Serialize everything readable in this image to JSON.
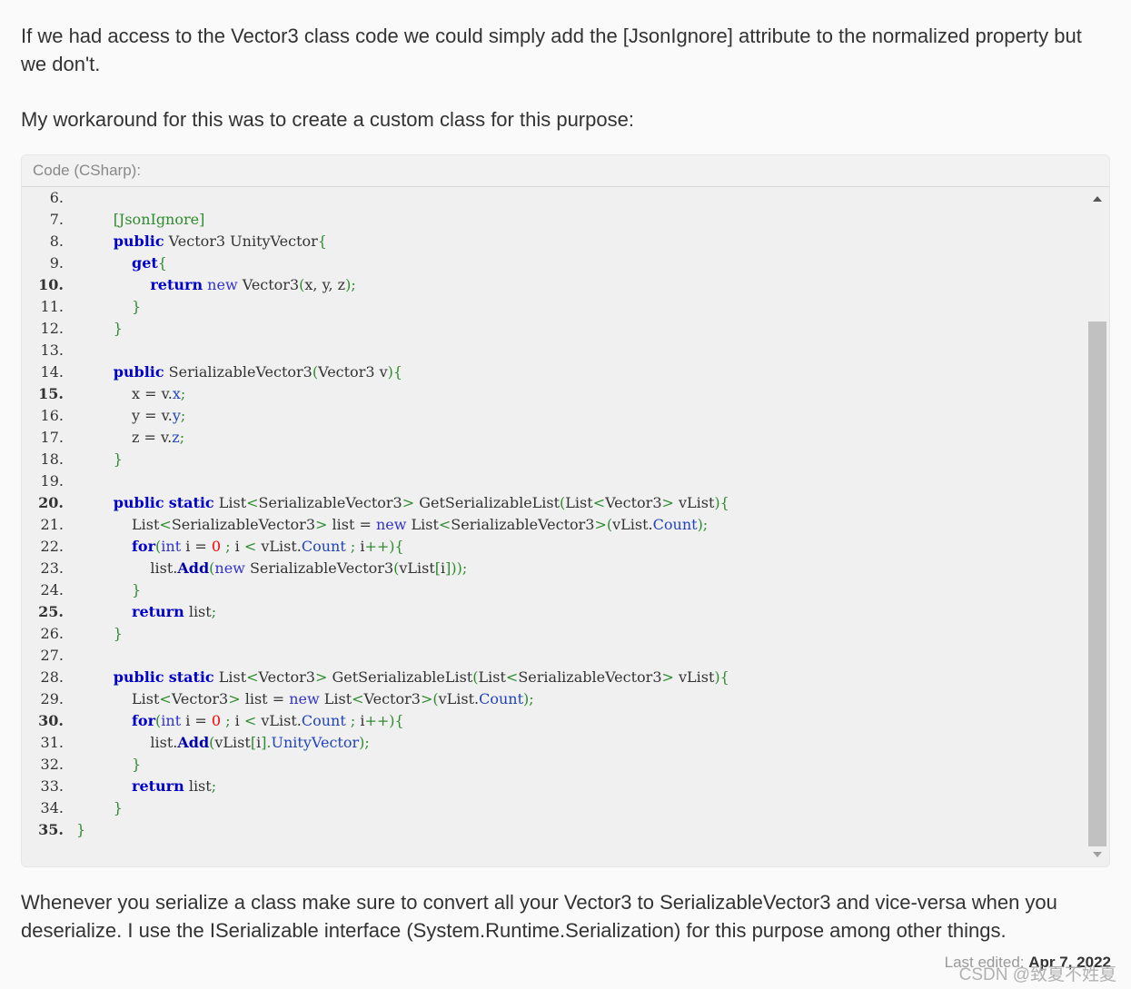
{
  "paragraphs": {
    "p1": "If we had access to the Vector3 class code we could simply add the [JsonIgnore] attribute to the normalized property but we don't.",
    "p2": "My workaround for this was to create a custom class for this purpose:",
    "p3": "Whenever you serialize a class make sure to convert all your Vector3 to SerializableVector3 and vice-versa when you deserialize. I use the ISerializable interface (System.Runtime.Serialization) for this purpose among other things."
  },
  "code_block": {
    "header": "Code (CSharp):",
    "lines": [
      {
        "n": "6.",
        "bold": false
      },
      {
        "n": "7.",
        "bold": false
      },
      {
        "n": "8.",
        "bold": false
      },
      {
        "n": "9.",
        "bold": false
      },
      {
        "n": "10.",
        "bold": true
      },
      {
        "n": "11.",
        "bold": false
      },
      {
        "n": "12.",
        "bold": false
      },
      {
        "n": "13.",
        "bold": false
      },
      {
        "n": "14.",
        "bold": false
      },
      {
        "n": "15.",
        "bold": true
      },
      {
        "n": "16.",
        "bold": false
      },
      {
        "n": "17.",
        "bold": false
      },
      {
        "n": "18.",
        "bold": false
      },
      {
        "n": "19.",
        "bold": false
      },
      {
        "n": "20.",
        "bold": true
      },
      {
        "n": "21.",
        "bold": false
      },
      {
        "n": "22.",
        "bold": false
      },
      {
        "n": "23.",
        "bold": false
      },
      {
        "n": "24.",
        "bold": false
      },
      {
        "n": "25.",
        "bold": true
      },
      {
        "n": "26.",
        "bold": false
      },
      {
        "n": "27.",
        "bold": false
      },
      {
        "n": "28.",
        "bold": false
      },
      {
        "n": "29.",
        "bold": false
      },
      {
        "n": "30.",
        "bold": true
      },
      {
        "n": "31.",
        "bold": false
      },
      {
        "n": "32.",
        "bold": false
      },
      {
        "n": "33.",
        "bold": false
      },
      {
        "n": "34.",
        "bold": false
      },
      {
        "n": "35.",
        "bold": true
      }
    ],
    "tokens": [
      [],
      [
        [
          "pn",
          "        [JsonIgnore]"
        ]
      ],
      [
        [
          "",
          "        "
        ],
        [
          "kw",
          "public"
        ],
        [
          "",
          " Vector3 UnityVector"
        ],
        [
          "pn",
          "{"
        ]
      ],
      [
        [
          "",
          "            "
        ],
        [
          "kw",
          "get"
        ],
        [
          "pn",
          "{"
        ]
      ],
      [
        [
          "",
          "                "
        ],
        [
          "kw",
          "return"
        ],
        [
          "",
          " "
        ],
        [
          "kt",
          "new"
        ],
        [
          "",
          " Vector3"
        ],
        [
          "pn",
          "("
        ],
        [
          "",
          "x, y, z"
        ],
        [
          "pn",
          ");"
        ]
      ],
      [
        [
          "",
          "            "
        ],
        [
          "pn",
          "}"
        ]
      ],
      [
        [
          "",
          "        "
        ],
        [
          "pn",
          "}"
        ]
      ],
      [],
      [
        [
          "",
          "        "
        ],
        [
          "kw",
          "public"
        ],
        [
          "",
          " SerializableVector3"
        ],
        [
          "pn",
          "("
        ],
        [
          "",
          "Vector3 v"
        ],
        [
          "pn",
          "){"
        ]
      ],
      [
        [
          "",
          "            x = v."
        ],
        [
          "mem",
          "x"
        ],
        [
          "pn",
          ";"
        ]
      ],
      [
        [
          "",
          "            y = v."
        ],
        [
          "mem",
          "y"
        ],
        [
          "pn",
          ";"
        ]
      ],
      [
        [
          "",
          "            z = v."
        ],
        [
          "mem",
          "z"
        ],
        [
          "pn",
          ";"
        ]
      ],
      [
        [
          "",
          "        "
        ],
        [
          "pn",
          "}"
        ]
      ],
      [],
      [
        [
          "",
          "        "
        ],
        [
          "kw",
          "public"
        ],
        [
          "",
          " "
        ],
        [
          "kw",
          "static"
        ],
        [
          "",
          " List"
        ],
        [
          "pn",
          "<"
        ],
        [
          "",
          "SerializableVector3"
        ],
        [
          "pn",
          ">"
        ],
        [
          "",
          " GetSerializableList"
        ],
        [
          "pn",
          "("
        ],
        [
          "",
          "List"
        ],
        [
          "pn",
          "<"
        ],
        [
          "",
          "Vector3"
        ],
        [
          "pn",
          ">"
        ],
        [
          "",
          " vList"
        ],
        [
          "pn",
          "){"
        ]
      ],
      [
        [
          "",
          "            List"
        ],
        [
          "pn",
          "<"
        ],
        [
          "",
          "SerializableVector3"
        ],
        [
          "pn",
          ">"
        ],
        [
          "",
          " list = "
        ],
        [
          "kt",
          "new"
        ],
        [
          "",
          " List"
        ],
        [
          "pn",
          "<"
        ],
        [
          "",
          "SerializableVector3"
        ],
        [
          "pn",
          ">("
        ],
        [
          "",
          "vList."
        ],
        [
          "mem",
          "Count"
        ],
        [
          "pn",
          ");"
        ]
      ],
      [
        [
          "",
          "            "
        ],
        [
          "kw",
          "for"
        ],
        [
          "pn",
          "("
        ],
        [
          "kt",
          "int"
        ],
        [
          "",
          " i = "
        ],
        [
          "num",
          "0"
        ],
        [
          "",
          " "
        ],
        [
          "pn",
          ";"
        ],
        [
          "",
          " i "
        ],
        [
          "pn",
          "<"
        ],
        [
          "",
          " vList."
        ],
        [
          "mem",
          "Count"
        ],
        [
          "",
          " "
        ],
        [
          "pn",
          ";"
        ],
        [
          "",
          " i"
        ],
        [
          "pn",
          "++){"
        ]
      ],
      [
        [
          "",
          "                list."
        ],
        [
          "mb",
          "Add"
        ],
        [
          "pn",
          "("
        ],
        [
          "kt",
          "new"
        ],
        [
          "",
          " SerializableVector3"
        ],
        [
          "pn",
          "("
        ],
        [
          "",
          "vList"
        ],
        [
          "pn",
          "["
        ],
        [
          "",
          "i"
        ],
        [
          "pn",
          "]));"
        ]
      ],
      [
        [
          "",
          "            "
        ],
        [
          "pn",
          "}"
        ]
      ],
      [
        [
          "",
          "            "
        ],
        [
          "kw",
          "return"
        ],
        [
          "",
          " list"
        ],
        [
          "pn",
          ";"
        ]
      ],
      [
        [
          "",
          "        "
        ],
        [
          "pn",
          "}"
        ]
      ],
      [],
      [
        [
          "",
          "        "
        ],
        [
          "kw",
          "public"
        ],
        [
          "",
          " "
        ],
        [
          "kw",
          "static"
        ],
        [
          "",
          " List"
        ],
        [
          "pn",
          "<"
        ],
        [
          "",
          "Vector3"
        ],
        [
          "pn",
          ">"
        ],
        [
          "",
          " GetSerializableList"
        ],
        [
          "pn",
          "("
        ],
        [
          "",
          "List"
        ],
        [
          "pn",
          "<"
        ],
        [
          "",
          "SerializableVector3"
        ],
        [
          "pn",
          ">"
        ],
        [
          "",
          " vList"
        ],
        [
          "pn",
          "){"
        ]
      ],
      [
        [
          "",
          "            List"
        ],
        [
          "pn",
          "<"
        ],
        [
          "",
          "Vector3"
        ],
        [
          "pn",
          ">"
        ],
        [
          "",
          " list = "
        ],
        [
          "kt",
          "new"
        ],
        [
          "",
          " List"
        ],
        [
          "pn",
          "<"
        ],
        [
          "",
          "Vector3"
        ],
        [
          "pn",
          ">("
        ],
        [
          "",
          "vList."
        ],
        [
          "mem",
          "Count"
        ],
        [
          "pn",
          ");"
        ]
      ],
      [
        [
          "",
          "            "
        ],
        [
          "kw",
          "for"
        ],
        [
          "pn",
          "("
        ],
        [
          "kt",
          "int"
        ],
        [
          "",
          " i = "
        ],
        [
          "num",
          "0"
        ],
        [
          "",
          " "
        ],
        [
          "pn",
          ";"
        ],
        [
          "",
          " i "
        ],
        [
          "pn",
          "<"
        ],
        [
          "",
          " vList."
        ],
        [
          "mem",
          "Count"
        ],
        [
          "",
          " "
        ],
        [
          "pn",
          ";"
        ],
        [
          "",
          " i"
        ],
        [
          "pn",
          "++){"
        ]
      ],
      [
        [
          "",
          "                list."
        ],
        [
          "mb",
          "Add"
        ],
        [
          "pn",
          "("
        ],
        [
          "",
          "vList"
        ],
        [
          "pn",
          "["
        ],
        [
          "",
          "i"
        ],
        [
          "pn",
          "]."
        ],
        [
          "mem",
          "UnityVector"
        ],
        [
          "pn",
          ");"
        ]
      ],
      [
        [
          "",
          "            "
        ],
        [
          "pn",
          "}"
        ]
      ],
      [
        [
          "",
          "            "
        ],
        [
          "kw",
          "return"
        ],
        [
          "",
          " list"
        ],
        [
          "pn",
          ";"
        ]
      ],
      [
        [
          "",
          "        "
        ],
        [
          "pn",
          "}"
        ]
      ],
      [
        [
          "",
          ""
        ],
        [
          "pn",
          "}"
        ]
      ]
    ]
  },
  "footer": {
    "last_edited_label": "Last edited:",
    "last_edited_date": "Apr 7, 2022",
    "watermark": "CSDN @致夏不姓夏"
  }
}
